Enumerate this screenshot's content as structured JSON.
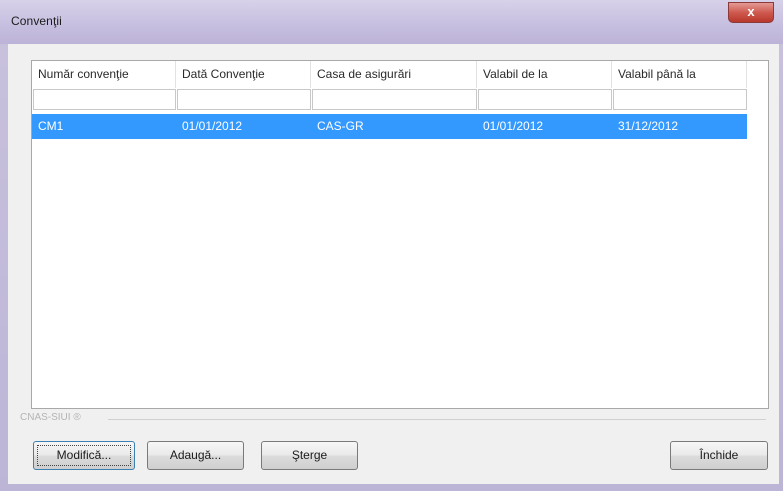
{
  "window": {
    "title": "Convenţii",
    "close_label": "x"
  },
  "table": {
    "columns": [
      "Număr convenţie",
      "Dată Convenţie",
      "Casa de asigurări",
      "Valabil de la",
      "Valabil până la"
    ],
    "rows": [
      [
        "CM1",
        "01/01/2012",
        "CAS-GR",
        "01/01/2012",
        "31/12/2012"
      ]
    ]
  },
  "group": {
    "label": "CNAS-SIUI ®"
  },
  "buttons": {
    "modify": "Modifică...",
    "add": "Adaugă...",
    "delete": "Şterge",
    "close": "Închide"
  }
}
